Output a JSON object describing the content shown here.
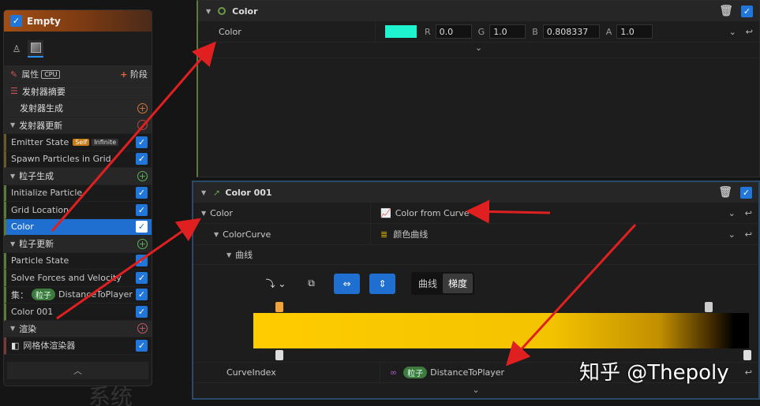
{
  "node": {
    "title": "Empty",
    "properties": "属性",
    "cpu_badge": "CPU",
    "stage": "阶段",
    "sections": {
      "summary": "发射器摘要",
      "emitter_spawn": "发射器生成",
      "emitter_update": "发射器更新",
      "particle_spawn": "粒子生成",
      "particle_update": "粒子更新",
      "render": "渲染"
    },
    "items": {
      "emitter_state": "Emitter State",
      "self_badge": "Self",
      "infinite_badge": "Infinite",
      "spawn_grid": "Spawn Particles in Grid",
      "init_particle": "Initialize Particle",
      "grid_location": "Grid Location",
      "color": "Color",
      "particle_state": "Particle State",
      "solve_forces": "Solve Forces and Velocity",
      "set_prefix": "集：",
      "particle_pill": "粒子",
      "distance": "DistanceToPlayer",
      "color001": "Color 001",
      "mesh_renderer": "网格体渲染器"
    }
  },
  "top_panel": {
    "title": "Color",
    "row_label": "Color",
    "swatch_color": "#1ff2cf",
    "r_label": "R",
    "r": "0.0",
    "g_label": "G",
    "g": "1.0",
    "b_label": "B",
    "b": "0.808337",
    "a_label": "A",
    "a": "1.0"
  },
  "bottom_panel": {
    "title": "Color 001",
    "color_label": "Color",
    "color_value": "Color from Curve",
    "curve_label": "ColorCurve",
    "curve_value": "颜色曲线",
    "sub_label": "曲线",
    "seg_curve": "曲线",
    "seg_gradient": "梯度",
    "index_label": "CurveIndex",
    "index_pill": "粒子",
    "index_value": "DistanceToPlayer"
  },
  "watermark": "知乎 @Thepoly",
  "ghost_text": "系统"
}
